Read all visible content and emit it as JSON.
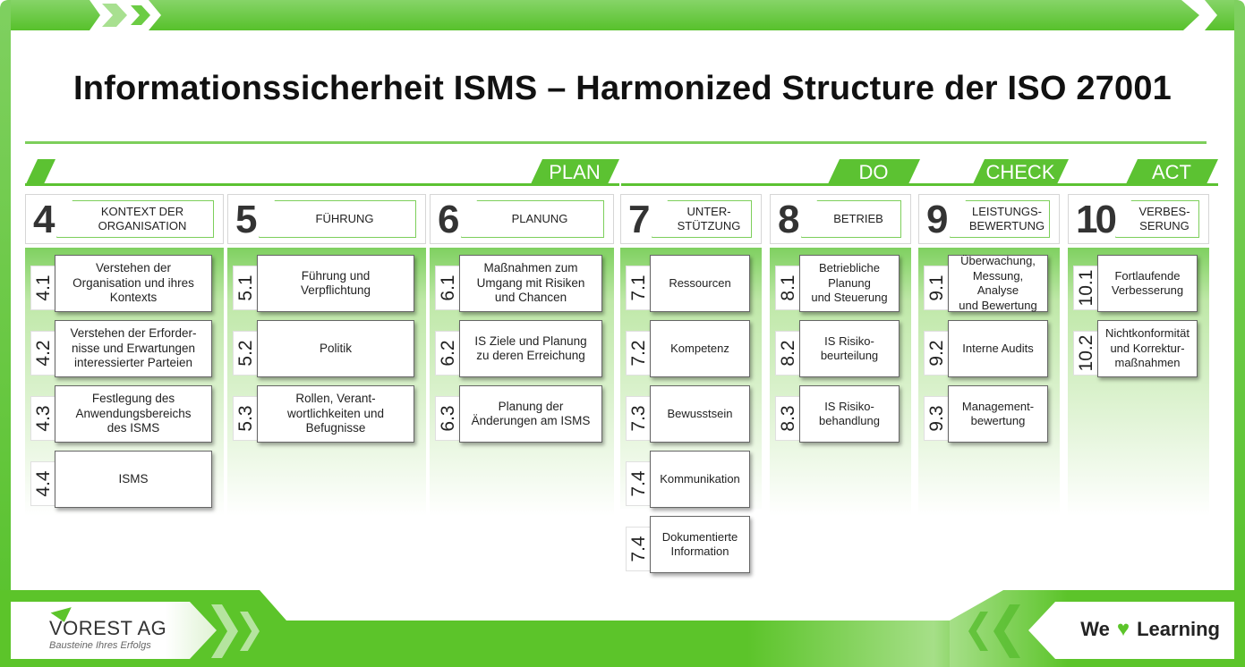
{
  "title": "Informationssicherheit ISMS – Harmonized Structure der ISO 27001",
  "colors": {
    "accent": "#5cc232",
    "accent_light": "#7dcf5b",
    "text": "#222222"
  },
  "phases": [
    {
      "label": "PLAN"
    },
    {
      "label": "DO"
    },
    {
      "label": "CHECK"
    },
    {
      "label": "ACT"
    }
  ],
  "columns": [
    {
      "number": "4",
      "title": "KONTEXT DER\nORGANISATION",
      "items": [
        {
          "num": "4.1",
          "text": "Verstehen der\nOrganisation und ihres\nKontexts"
        },
        {
          "num": "4.2",
          "text": "Verstehen der Erforder-\nnisse und Erwartungen\ninteressierter Parteien"
        },
        {
          "num": "4.3",
          "text": "Festlegung des\nAnwendungsbereichs\ndes ISMS"
        },
        {
          "num": "4.4",
          "text": "ISMS"
        }
      ]
    },
    {
      "number": "5",
      "title": "FÜHRUNG",
      "items": [
        {
          "num": "5.1",
          "text": "Führung und\nVerpflichtung"
        },
        {
          "num": "5.2",
          "text": "Politik"
        },
        {
          "num": "5.3",
          "text": "Rollen, Verant-\nwortlichkeiten und\nBefugnisse"
        }
      ]
    },
    {
      "number": "6",
      "title": "PLANUNG",
      "items": [
        {
          "num": "6.1",
          "text": "Maßnahmen zum\nUmgang mit Risiken\nund Chancen"
        },
        {
          "num": "6.2",
          "text": "IS Ziele und Planung\nzu deren Erreichung"
        },
        {
          "num": "6.3",
          "text": "Planung der\nÄnderungen am ISMS"
        }
      ]
    },
    {
      "number": "7",
      "title": "UNTER-\nSTÜTZUNG",
      "items": [
        {
          "num": "7.1",
          "text": "Ressourcen"
        },
        {
          "num": "7.2",
          "text": "Kompetenz"
        },
        {
          "num": "7.3",
          "text": "Bewusstsein"
        },
        {
          "num": "7.4",
          "text": "Kommunikation"
        },
        {
          "num": "7.4",
          "text": "Dokumentierte\nInformation"
        }
      ]
    },
    {
      "number": "8",
      "title": "BETRIEB",
      "items": [
        {
          "num": "8.1",
          "text": "Betriebliche\nPlanung\nund Steuerung"
        },
        {
          "num": "8.2",
          "text": "IS Risiko-\nbeurteilung"
        },
        {
          "num": "8.3",
          "text": "IS Risiko-\nbehandlung"
        }
      ]
    },
    {
      "number": "9",
      "title": "LEISTUNGS-\nBEWERTUNG",
      "items": [
        {
          "num": "9.1",
          "text": "Überwachung,\nMessung, Analyse\nund Bewertung"
        },
        {
          "num": "9.2",
          "text": "Interne Audits"
        },
        {
          "num": "9.3",
          "text": "Management-\nbewertung"
        }
      ]
    },
    {
      "number": "10",
      "title": "VERBES-\nSERUNG",
      "items": [
        {
          "num": "10.1",
          "text": "Fortlaufende\nVerbesserung"
        },
        {
          "num": "10.2",
          "text": "Nichtkonformität\nund Korrektur-\nmaßnahmen"
        }
      ]
    }
  ],
  "footer": {
    "logo_name": "VOREST AG",
    "logo_tagline": "Bausteine Ihres Erfolgs",
    "slogan_left": "We",
    "slogan_icon": "heart-icon",
    "slogan_right": "Learning"
  }
}
